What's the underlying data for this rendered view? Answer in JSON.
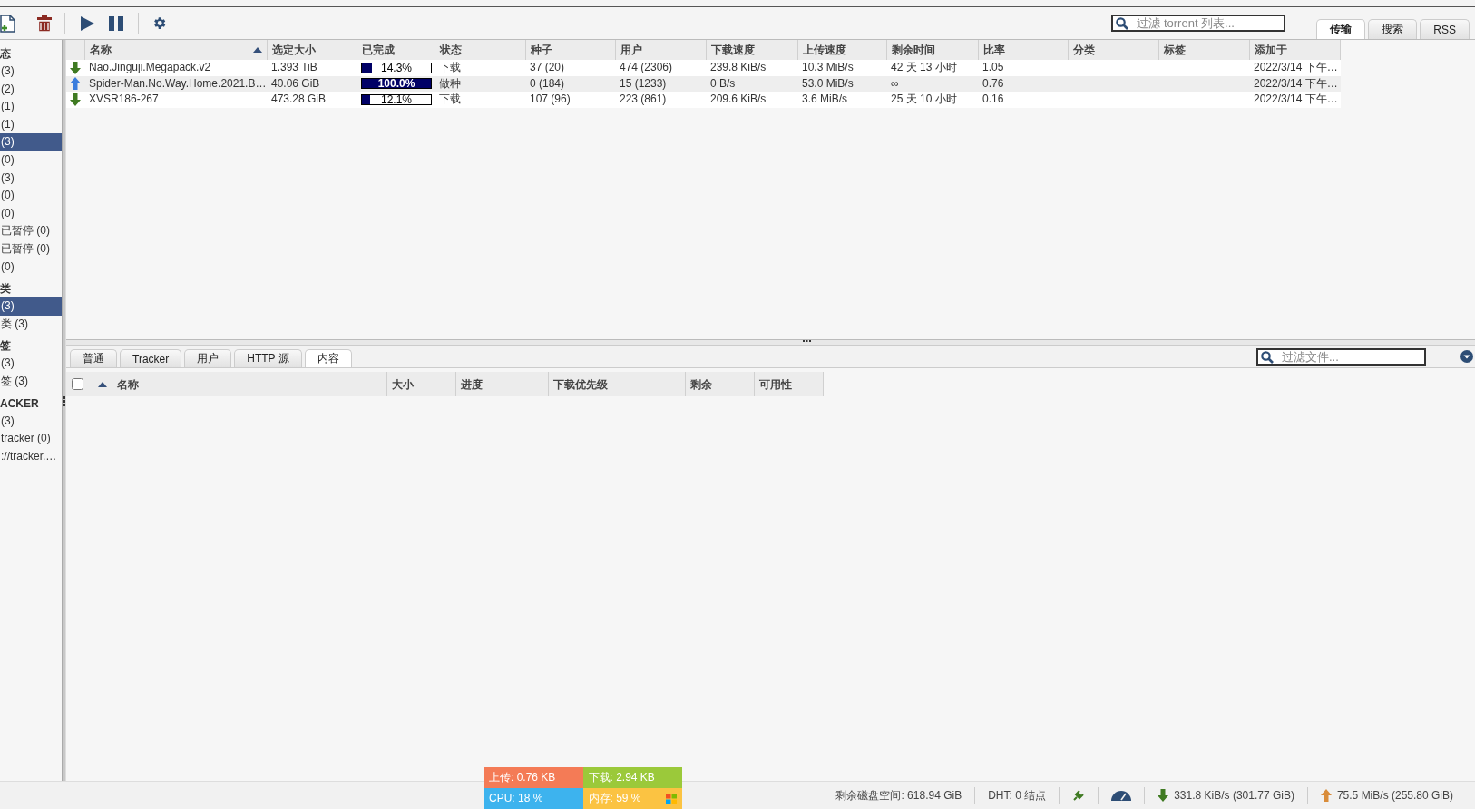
{
  "toolbar": {
    "filter": {
      "placeholder": "过滤 torrent 列表..."
    },
    "tabs": [
      {
        "label": "传输",
        "selected": true
      },
      {
        "label": "搜索",
        "selected": false
      },
      {
        "label": "RSS",
        "selected": false
      }
    ]
  },
  "sidebar": {
    "sections": [
      {
        "title": "态",
        "items": [
          {
            "label": "(3)",
            "selected": false
          },
          {
            "label": "(2)",
            "selected": false
          },
          {
            "label": "(1)",
            "selected": false
          },
          {
            "label": "(1)",
            "selected": false
          },
          {
            "label": "(3)",
            "selected": true
          },
          {
            "label": "(0)",
            "selected": false
          },
          {
            "label": "(3)",
            "selected": false
          },
          {
            "label": "(0)",
            "selected": false
          },
          {
            "label": "(0)",
            "selected": false
          },
          {
            "label": "已暂停 (0)",
            "selected": false
          },
          {
            "label": "已暂停 (0)",
            "selected": false
          },
          {
            "label": "(0)",
            "selected": false
          }
        ]
      },
      {
        "title": "类",
        "items": [
          {
            "label": "(3)",
            "selected": true
          },
          {
            "label": "类 (3)",
            "selected": false
          }
        ]
      },
      {
        "title": "签",
        "items": [
          {
            "label": "(3)",
            "selected": false
          },
          {
            "label": "签 (3)",
            "selected": false
          }
        ]
      },
      {
        "title": "ACKER",
        "items": [
          {
            "label": "(3)",
            "selected": false
          },
          {
            "label": "tracker (0)",
            "selected": false
          },
          {
            "label": "://tracker.…",
            "selected": false
          }
        ]
      }
    ]
  },
  "torrent_table": {
    "columns": [
      {
        "label": "名称",
        "sorted": true
      },
      {
        "label": "选定大小",
        "sorted": false
      },
      {
        "label": "已完成",
        "sorted": false
      },
      {
        "label": "状态",
        "sorted": false
      },
      {
        "label": "种子",
        "sorted": false
      },
      {
        "label": "用户",
        "sorted": false
      },
      {
        "label": "下载速度",
        "sorted": false
      },
      {
        "label": "上传速度",
        "sorted": false
      },
      {
        "label": "剩余时间",
        "sorted": false
      },
      {
        "label": "比率",
        "sorted": false
      },
      {
        "label": "分类",
        "sorted": false
      },
      {
        "label": "标签",
        "sorted": false
      },
      {
        "label": "添加于",
        "sorted": false
      }
    ],
    "rows": [
      {
        "kind": "downloading",
        "name": "Nao.Jinguji.Megapack.v2",
        "size": "1.393 TiB",
        "progress": {
          "level": 0.143,
          "label": "14.3%"
        },
        "status": "下载",
        "seeds": "37 (20)",
        "peers": "474 (2306)",
        "down_speed": "239.8 KiB/s",
        "up_speed": "10.3 MiB/s",
        "eta": "42 天 13 小时",
        "ratio": "1.05",
        "added": "2022/3/14 下午…"
      },
      {
        "kind": "seeding",
        "name": "Spider-Man.No.Way.Home.2021.B…",
        "size": "40.06 GiB",
        "progress": {
          "level": 1.0,
          "label": "100.0%"
        },
        "status": "做种",
        "seeds": "0 (184)",
        "peers": "15 (1233)",
        "down_speed": "0 B/s",
        "up_speed": "53.0 MiB/s",
        "eta": "∞",
        "ratio": "0.76",
        "added": "2022/3/14 下午…"
      },
      {
        "kind": "downloading",
        "name": "XVSR186-267",
        "size": "473.28 GiB",
        "progress": {
          "level": 0.121,
          "label": "12.1%"
        },
        "status": "下载",
        "seeds": "107 (96)",
        "peers": "223 (861)",
        "down_speed": "209.6 KiB/s",
        "up_speed": "3.6 MiB/s",
        "eta": "25 天 10 小时",
        "ratio": "0.16",
        "added": "2022/3/14 下午…"
      }
    ]
  },
  "details": {
    "tabs": [
      {
        "label": "普通",
        "selected": false
      },
      {
        "label": "Tracker",
        "selected": false
      },
      {
        "label": "用户",
        "selected": false
      },
      {
        "label": "HTTP 源",
        "selected": false
      },
      {
        "label": "内容",
        "selected": true
      }
    ],
    "filter": {
      "placeholder": "过滤文件..."
    },
    "select_all": {
      "checked": false
    },
    "columns": [
      {
        "label": "名称",
        "sorted": true
      },
      {
        "label": "大小",
        "sorted": false
      },
      {
        "label": "进度",
        "sorted": false
      },
      {
        "label": "下载优先级",
        "sorted": false
      },
      {
        "label": "剩余",
        "sorted": false
      },
      {
        "label": "可用性",
        "sorted": false
      }
    ]
  },
  "monitor": {
    "cells": [
      {
        "label": "上传: 0.76 KB",
        "color": "#f47b56"
      },
      {
        "label": "下载: 2.94 KB",
        "color": "#9bc93a"
      },
      {
        "label": "CPU: 18 %",
        "color": "#3db3ee"
      },
      {
        "label": "内存: 59 %",
        "color": "#fbc342"
      }
    ]
  },
  "status_bar": {
    "free_space": "剩余磁盘空间: 618.94 GiB",
    "dht": "DHT: 0 结点",
    "download": "331.8 KiB/s (301.77 GiB)",
    "upload": "75.5 MiB/s (255.80 GiB)"
  }
}
